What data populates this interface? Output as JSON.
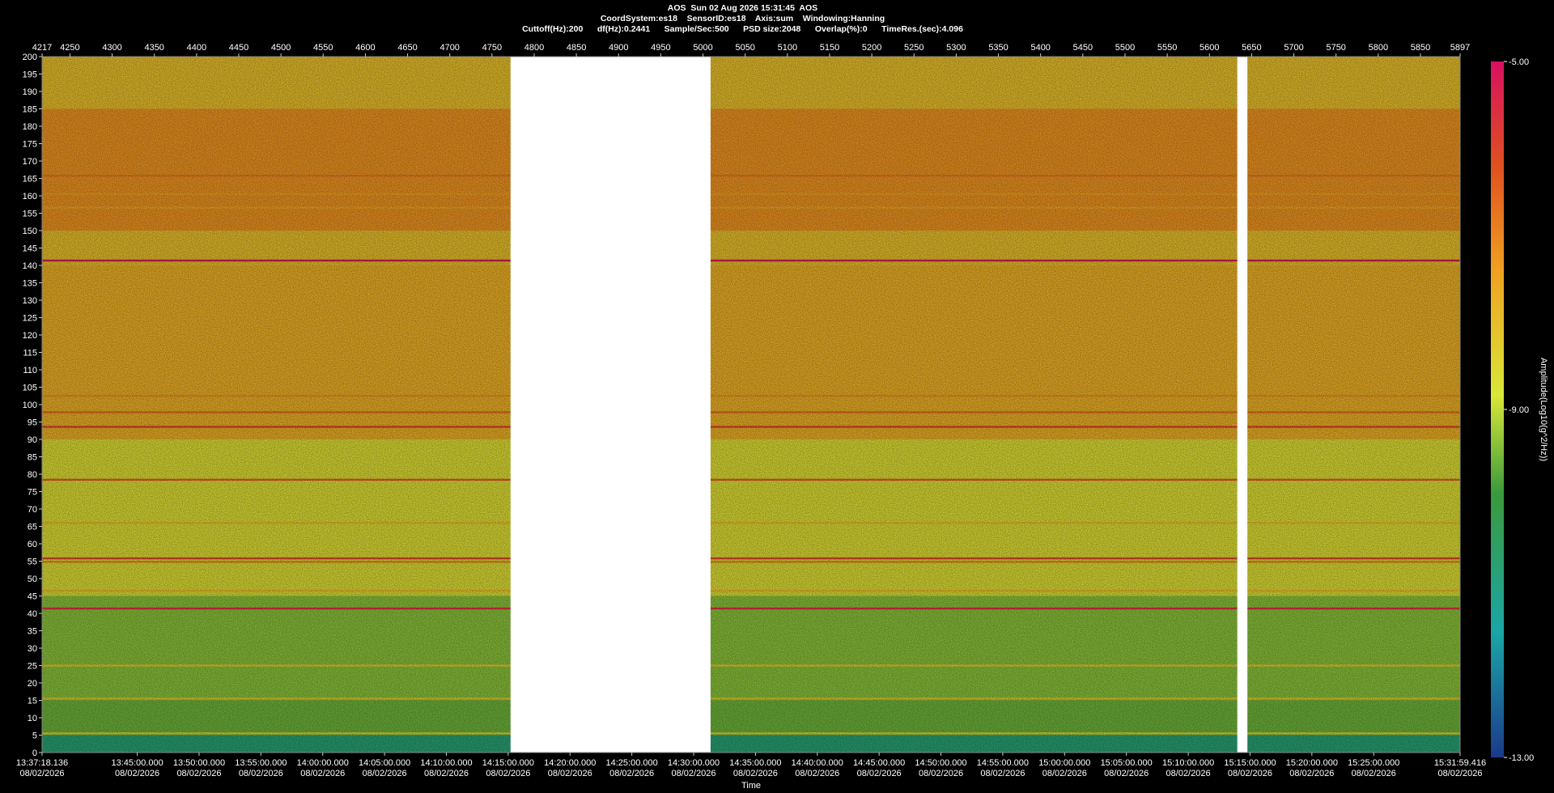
{
  "header": {
    "line1": "AOS  Sun 02 Aug 2026 15:31:45  AOS",
    "line2": "CoordSystem:es18    SensorID:es18    Axis:sum    Windowing:Hanning",
    "line3": "Cuttoff(Hz):200      df(Hz):0.2441      Sample/Sec:500      PSD size:2048      Overlap(%):0      TimeRes.(sec):4.096"
  },
  "colors": {
    "background": "#000000",
    "gap": "#ffffff",
    "text": "#ffffff"
  },
  "chart_data": {
    "type": "heatmap",
    "title": "AOS  Sun 02 Aug 2026 15:31:45  AOS",
    "xlabel": "Time",
    "ylabel": "",
    "colorbar_label": "Amplitude(Log10(g^2/Hz))",
    "colormap": [
      "#1a3a8c",
      "#1aa6a6",
      "#3a9a3a",
      "#d8e838",
      "#f0a020",
      "#e05020",
      "#d81060"
    ],
    "clim": [
      -13.0,
      -5.0
    ],
    "colorbar_ticks": [
      "-5.00",
      "-9.00",
      "-13.00"
    ],
    "ylim": [
      0,
      200
    ],
    "y_ticks": [
      200,
      195,
      190,
      185,
      180,
      175,
      170,
      165,
      160,
      155,
      150,
      145,
      140,
      135,
      130,
      125,
      120,
      115,
      110,
      105,
      100,
      95,
      90,
      85,
      80,
      75,
      70,
      65,
      60,
      55,
      50,
      45,
      40,
      35,
      30,
      25,
      20,
      15,
      10,
      5,
      0
    ],
    "frame_range": [
      4217,
      5897
    ],
    "frame_ticks": [
      4217,
      4250,
      4300,
      4350,
      4400,
      4450,
      4500,
      4550,
      4600,
      4650,
      4700,
      4750,
      4800,
      4850,
      4900,
      4950,
      5000,
      5050,
      5100,
      5150,
      5200,
      5250,
      5300,
      5350,
      5400,
      5450,
      5500,
      5550,
      5600,
      5650,
      5700,
      5750,
      5800,
      5850,
      5897
    ],
    "time_range": [
      "13:37:18.136",
      "15:31:59.416"
    ],
    "time_ticks": [
      {
        "time": "13:37:18.136",
        "date": "08/02/2026"
      },
      {
        "time": "13:45:00.000",
        "date": "08/02/2026"
      },
      {
        "time": "13:50:00.000",
        "date": "08/02/2026"
      },
      {
        "time": "13:55:00.000",
        "date": "08/02/2026"
      },
      {
        "time": "14:00:00.000",
        "date": "08/02/2026"
      },
      {
        "time": "14:05:00.000",
        "date": "08/02/2026"
      },
      {
        "time": "14:10:00.000",
        "date": "08/02/2026"
      },
      {
        "time": "14:15:00.000",
        "date": "08/02/2026"
      },
      {
        "time": "14:20:00.000",
        "date": "08/02/2026"
      },
      {
        "time": "14:25:00.000",
        "date": "08/02/2026"
      },
      {
        "time": "14:30:00.000",
        "date": "08/02/2026"
      },
      {
        "time": "14:35:00.000",
        "date": "08/02/2026"
      },
      {
        "time": "14:40:00.000",
        "date": "08/02/2026"
      },
      {
        "time": "14:45:00.000",
        "date": "08/02/2026"
      },
      {
        "time": "14:50:00.000",
        "date": "08/02/2026"
      },
      {
        "time": "14:55:00.000",
        "date": "08/02/2026"
      },
      {
        "time": "15:00:00.000",
        "date": "08/02/2026"
      },
      {
        "time": "15:05:00.000",
        "date": "08/02/2026"
      },
      {
        "time": "15:10:00.000",
        "date": "08/02/2026"
      },
      {
        "time": "15:15:00.000",
        "date": "08/02/2026"
      },
      {
        "time": "15:20:00.000",
        "date": "08/02/2026"
      },
      {
        "time": "15:25:00.000",
        "date": "08/02/2026"
      },
      {
        "time": "15:31:59.416",
        "date": "08/02/2026"
      }
    ],
    "data_gaps_frames": [
      [
        4772,
        5009
      ],
      [
        5633,
        5645
      ]
    ],
    "spectral_lines_hz": [
      {
        "hz": 141.4,
        "level": -5.2
      },
      {
        "hz": 93.6,
        "level": -6.0
      },
      {
        "hz": 97.8,
        "level": -6.6
      },
      {
        "hz": 78.4,
        "level": -6.4
      },
      {
        "hz": 55.8,
        "level": -6.0
      },
      {
        "hz": 54.8,
        "level": -7.0
      },
      {
        "hz": 41.4,
        "level": -5.6
      },
      {
        "hz": 165.8,
        "level": -6.8
      },
      {
        "hz": 160.5,
        "level": -7.4
      },
      {
        "hz": 156.6,
        "level": -7.5
      },
      {
        "hz": 102.5,
        "level": -7.2
      },
      {
        "hz": 66.0,
        "level": -8.0
      },
      {
        "hz": 46.5,
        "level": -8.0
      },
      {
        "hz": 25.0,
        "level": -8.2
      },
      {
        "hz": 15.5,
        "level": -8.2
      },
      {
        "hz": 5.5,
        "level": -8.4
      }
    ],
    "band_levels": [
      {
        "range": [
          0,
          5
        ],
        "level": -10.8
      },
      {
        "range": [
          5,
          15
        ],
        "level": -9.6
      },
      {
        "range": [
          15,
          45
        ],
        "level": -9.4
      },
      {
        "range": [
          45,
          90
        ],
        "level": -8.6
      },
      {
        "range": [
          90,
          140
        ],
        "level": -7.7
      },
      {
        "range": [
          140,
          150
        ],
        "level": -8.0
      },
      {
        "range": [
          150,
          185
        ],
        "level": -7.2
      },
      {
        "range": [
          185,
          200
        ],
        "level": -8.0
      }
    ]
  }
}
